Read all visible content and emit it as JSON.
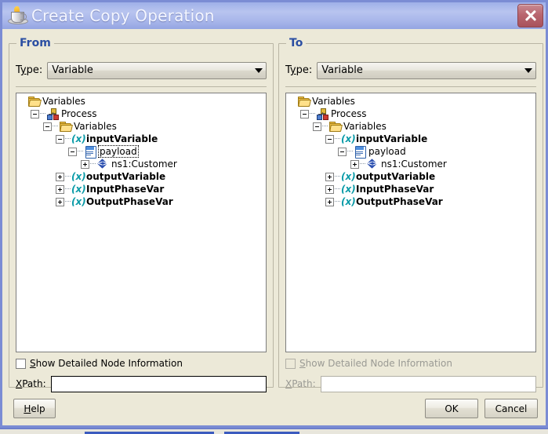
{
  "window": {
    "title": "Create Copy Operation",
    "app_icon": "java-coffee-cup-icon",
    "close_label": "×"
  },
  "panels": [
    {
      "id": "from",
      "group_label": "From",
      "type_label_pre": "T",
      "type_label_mn": "y",
      "type_label_post": "pe:",
      "type_value": "Variable",
      "enabled": true,
      "checkbox": {
        "label_pre": "",
        "label_mn": "S",
        "label_post": "how Detailed Node Information",
        "checked": false,
        "enabled": true
      },
      "xpath": {
        "label_pre": "",
        "label_mn": "X",
        "label_post": "Path:",
        "value": "",
        "placeholder": "",
        "enabled": true
      },
      "tree": [
        {
          "depth": 0,
          "toggle": "none",
          "icon": "folder",
          "label": "Variables",
          "bold": false,
          "selected": false
        },
        {
          "depth": 1,
          "toggle": "minus",
          "icon": "process",
          "label": "Process",
          "bold": false,
          "selected": false
        },
        {
          "depth": 2,
          "toggle": "minus",
          "icon": "folder",
          "label": "Variables",
          "bold": false,
          "selected": false
        },
        {
          "depth": 3,
          "toggle": "minus",
          "icon": "variable",
          "label": "inputVariable",
          "bold": true,
          "selected": false
        },
        {
          "depth": 4,
          "toggle": "minus",
          "icon": "document",
          "label": "payload",
          "bold": false,
          "selected": true
        },
        {
          "depth": 5,
          "toggle": "plus",
          "icon": "xml",
          "label": "ns1:Customer",
          "bold": false,
          "selected": false
        },
        {
          "depth": 3,
          "toggle": "plus",
          "icon": "variable",
          "label": "outputVariable",
          "bold": true,
          "selected": false
        },
        {
          "depth": 3,
          "toggle": "plus",
          "icon": "variable",
          "label": "InputPhaseVar",
          "bold": true,
          "selected": false
        },
        {
          "depth": 3,
          "toggle": "plus",
          "icon": "variable",
          "label": "OutputPhaseVar",
          "bold": true,
          "selected": false
        }
      ]
    },
    {
      "id": "to",
      "group_label": "To",
      "type_label_pre": "T",
      "type_label_mn": "y",
      "type_label_post": "pe:",
      "type_value": "Variable",
      "enabled": true,
      "checkbox": {
        "label_pre": "",
        "label_mn": "S",
        "label_post": "how Detailed Node Information",
        "checked": false,
        "enabled": false
      },
      "xpath": {
        "label_pre": "",
        "label_mn": "X",
        "label_post": "Path:",
        "value": "",
        "placeholder": "",
        "enabled": false
      },
      "tree": [
        {
          "depth": 0,
          "toggle": "none",
          "icon": "folder",
          "label": "Variables",
          "bold": false,
          "selected": false
        },
        {
          "depth": 1,
          "toggle": "minus",
          "icon": "process",
          "label": "Process",
          "bold": false,
          "selected": false
        },
        {
          "depth": 2,
          "toggle": "minus",
          "icon": "folder",
          "label": "Variables",
          "bold": false,
          "selected": false
        },
        {
          "depth": 3,
          "toggle": "minus",
          "icon": "variable",
          "label": "inputVariable",
          "bold": true,
          "selected": false
        },
        {
          "depth": 4,
          "toggle": "minus",
          "icon": "document",
          "label": "payload",
          "bold": false,
          "selected": false
        },
        {
          "depth": 5,
          "toggle": "plus",
          "icon": "xml",
          "label": "ns1:Customer",
          "bold": false,
          "selected": false
        },
        {
          "depth": 3,
          "toggle": "plus",
          "icon": "variable",
          "label": "outputVariable",
          "bold": true,
          "selected": false
        },
        {
          "depth": 3,
          "toggle": "plus",
          "icon": "variable",
          "label": "InputPhaseVar",
          "bold": true,
          "selected": false
        },
        {
          "depth": 3,
          "toggle": "plus",
          "icon": "variable",
          "label": "OutputPhaseVar",
          "bold": true,
          "selected": false
        }
      ]
    }
  ],
  "footer": {
    "help_pre": "",
    "help_mn": "H",
    "help_post": "elp",
    "ok_label": "OK",
    "cancel_label": "Cancel"
  },
  "colors": {
    "titlebar": "#a8b6ea",
    "group_label": "#2b4ea2",
    "dialog_bg": "#ece9d8",
    "close_button": "#b9666f",
    "variable_icon": "#0a9ba8",
    "folder_icon": "#f2c44c",
    "xml_icon": "#2b4fb0",
    "disabled_text": "#9a9a94"
  }
}
